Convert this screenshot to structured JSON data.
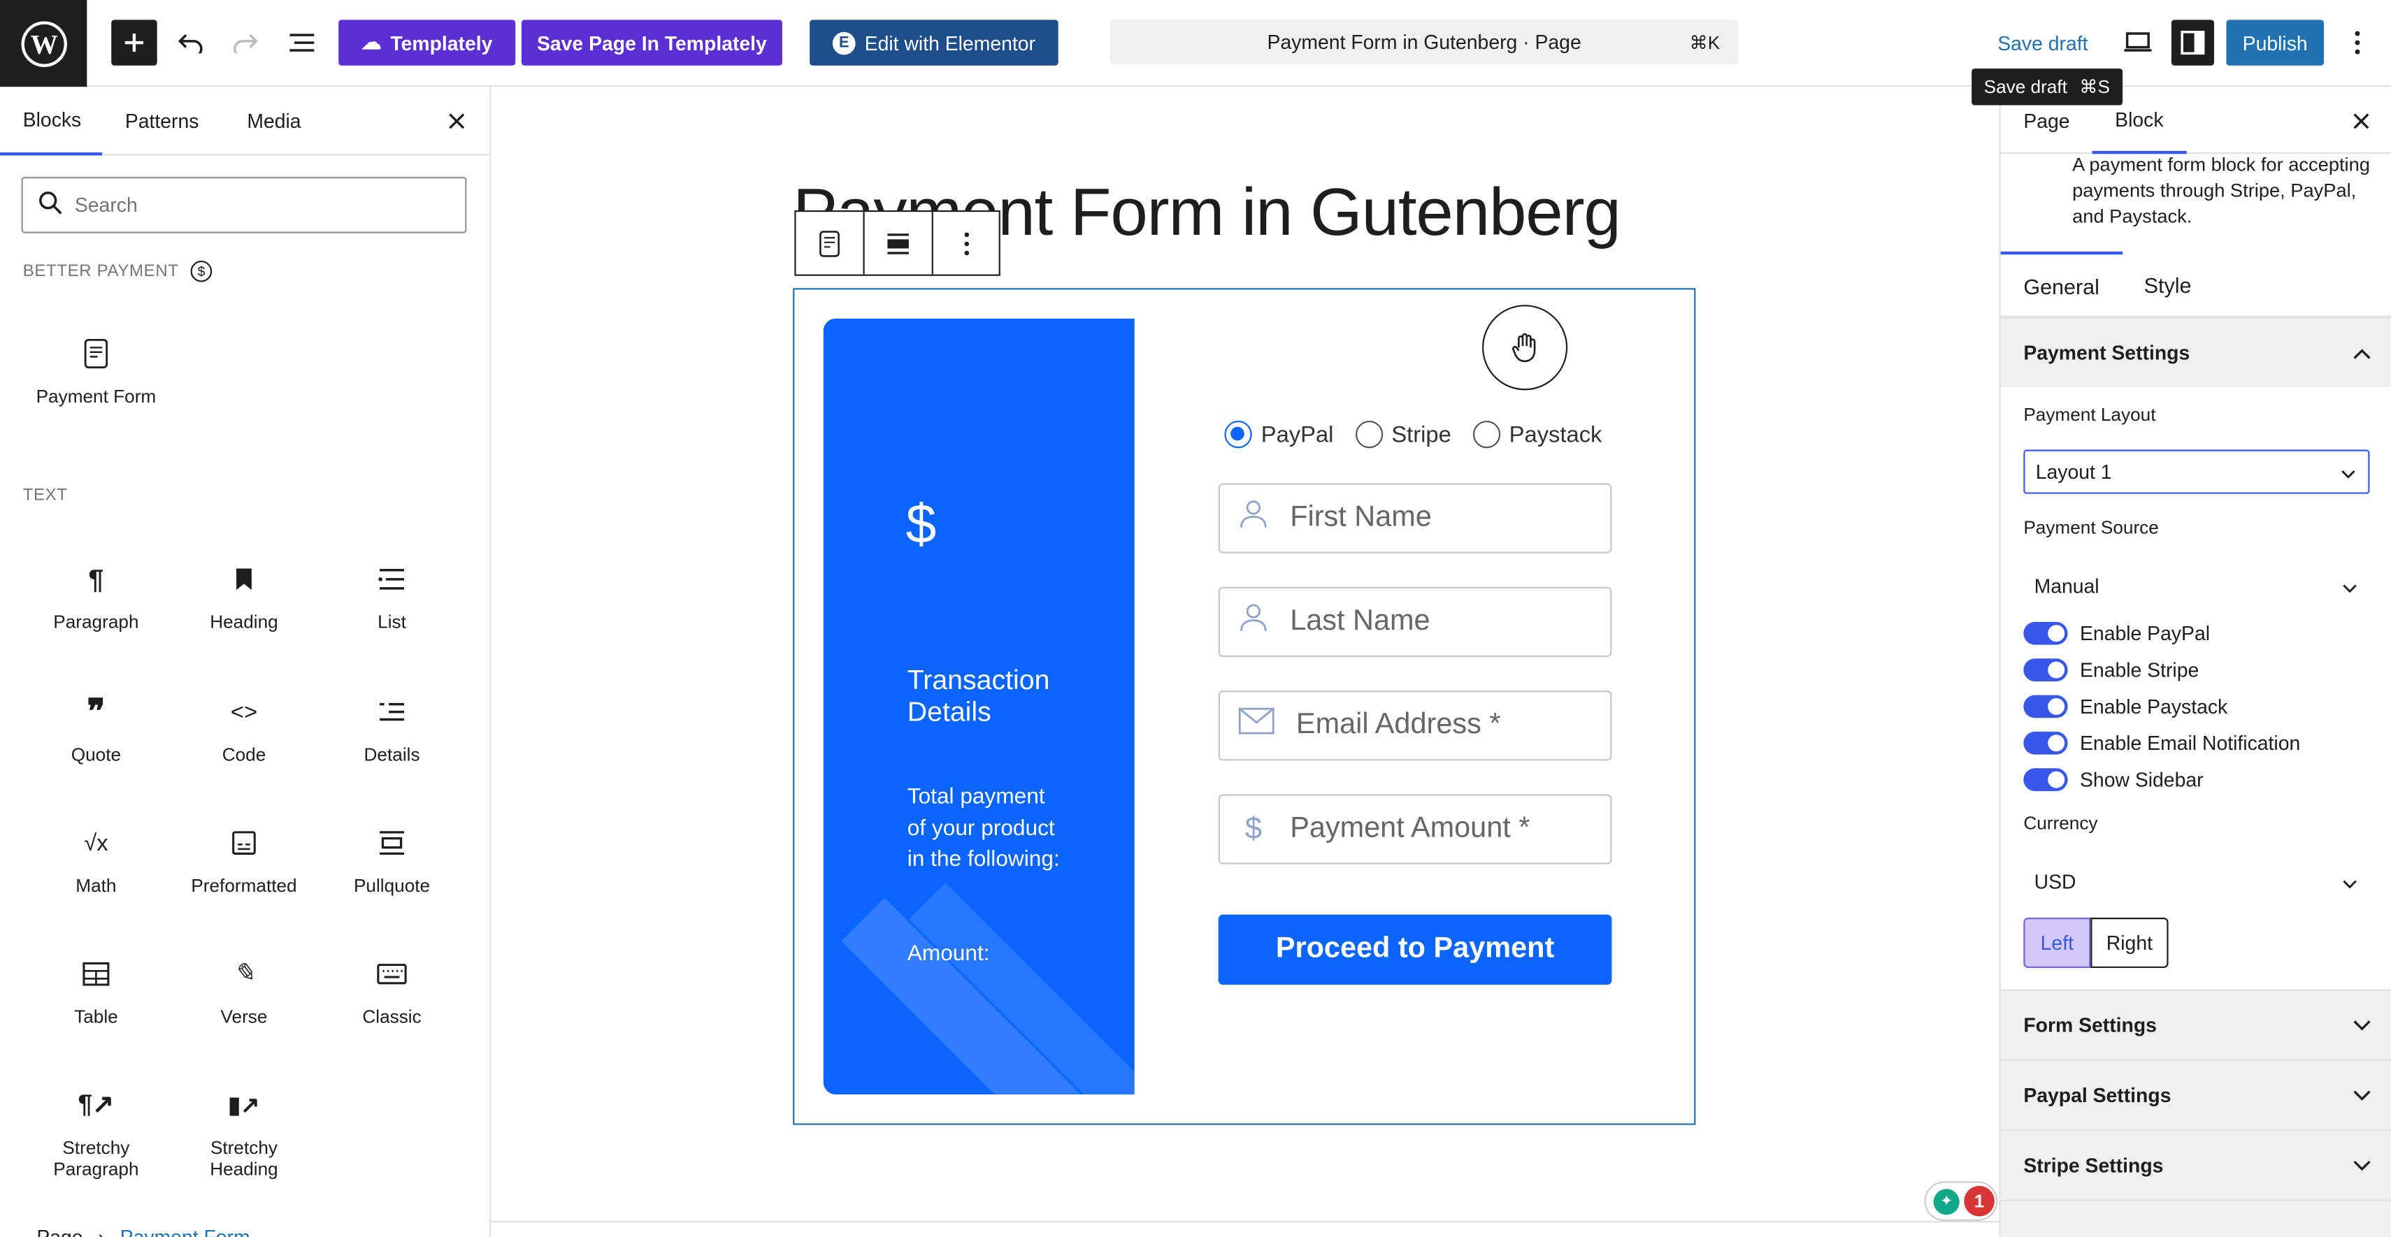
{
  "topbar": {
    "templately_label": "Templately",
    "save_templately_label": "Save Page In Templately",
    "elementor_label": "Edit with Elementor",
    "command_title": "Payment Form in Gutenberg · Page",
    "command_shortcut": "⌘K",
    "save_draft_label": "Save draft",
    "publish_label": "Publish",
    "tooltip_label": "Save draft",
    "tooltip_shortcut": "⌘S"
  },
  "inserter": {
    "tabs": [
      "Blocks",
      "Patterns",
      "Media"
    ],
    "search_placeholder": "Search",
    "section_better_payment": "BETTER PAYMENT",
    "payment_form_label": "Payment Form",
    "section_text": "TEXT",
    "blocks": [
      "Paragraph",
      "Heading",
      "List",
      "Quote",
      "Code",
      "Details",
      "Math",
      "Preformatted",
      "Pullquote",
      "Table",
      "Verse",
      "Classic",
      "Stretchy Paragraph",
      "Stretchy Heading"
    ]
  },
  "canvas": {
    "page_title": "Payment Form in Gutenberg",
    "card": {
      "currency_symbol": "$",
      "heading": "Transaction Details",
      "body_text": "Total payment of your product in the following:",
      "amount_label": "Amount:"
    },
    "radios": [
      "PayPal",
      "Stripe",
      "Paystack"
    ],
    "selected_radio": "PayPal",
    "fields": {
      "first_name": "First Name",
      "last_name": "Last Name",
      "email": "Email Address *",
      "amount": "Payment Amount *"
    },
    "submit_label": "Proceed to Payment",
    "breadcrumb": [
      "Page",
      "Payment Form"
    ],
    "notification_count": "1"
  },
  "settings": {
    "tabs": [
      "Page",
      "Block"
    ],
    "block_description": "A payment form block for accepting payments through Stripe, PayPal, and Paystack.",
    "subtabs": [
      "General",
      "Style"
    ],
    "payment_settings_title": "Payment Settings",
    "payment_layout_label": "Payment Layout",
    "payment_layout_value": "Layout 1",
    "payment_source_label": "Payment Source",
    "payment_source_value": "Manual",
    "toggles": [
      "Enable PayPal",
      "Enable Stripe",
      "Enable Paystack",
      "Enable Email Notification",
      "Show Sidebar"
    ],
    "currency_label": "Currency",
    "currency_value": "USD",
    "align_left": "Left",
    "align_right": "Right",
    "form_settings": "Form Settings",
    "paypal_settings": "Paypal Settings",
    "stripe_settings": "Stripe Settings"
  },
  "colors": {
    "accent": "#3858e9",
    "card_blue": "#0a64ff",
    "templately_purple": "#5b2fd4",
    "elementor_blue": "#1d4e89",
    "publish": "#2271b1"
  }
}
